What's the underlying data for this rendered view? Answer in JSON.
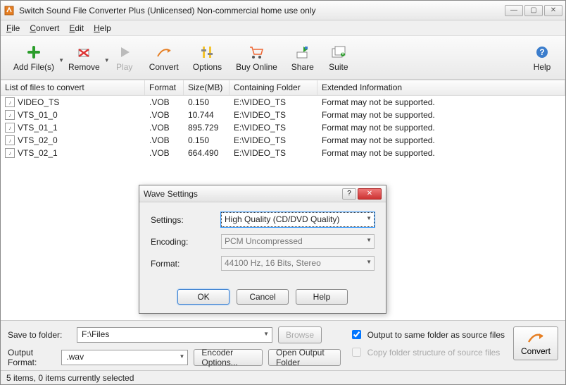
{
  "window": {
    "title": "Switch Sound File Converter Plus (Unlicensed) Non-commercial home use only"
  },
  "menu": {
    "file": "File",
    "convert": "Convert",
    "edit": "Edit",
    "help": "Help"
  },
  "toolbar": {
    "addfiles": "Add File(s)",
    "remove": "Remove",
    "play": "Play",
    "convert": "Convert",
    "options": "Options",
    "buyonline": "Buy Online",
    "share": "Share",
    "suite": "Suite",
    "help": "Help"
  },
  "columns": {
    "file": "List of files to convert",
    "format": "Format",
    "size": "Size(MB)",
    "folder": "Containing Folder",
    "ext": "Extended Information"
  },
  "rows": [
    {
      "name": "VIDEO_TS",
      "fmt": ".VOB",
      "size": "0.150",
      "folder": "E:\\VIDEO_TS",
      "ext": "Format may not be supported."
    },
    {
      "name": "VTS_01_0",
      "fmt": ".VOB",
      "size": "10.744",
      "folder": "E:\\VIDEO_TS",
      "ext": "Format may not be supported."
    },
    {
      "name": "VTS_01_1",
      "fmt": ".VOB",
      "size": "895.729",
      "folder": "E:\\VIDEO_TS",
      "ext": "Format may not be supported."
    },
    {
      "name": "VTS_02_0",
      "fmt": ".VOB",
      "size": "0.150",
      "folder": "E:\\VIDEO_TS",
      "ext": "Format may not be supported."
    },
    {
      "name": "VTS_02_1",
      "fmt": ".VOB",
      "size": "664.490",
      "folder": "E:\\VIDEO_TS",
      "ext": "Format may not be supported."
    }
  ],
  "dialog": {
    "title": "Wave Settings",
    "settings_lbl": "Settings:",
    "settings_val": "High Quality (CD/DVD Quality)",
    "encoding_lbl": "Encoding:",
    "encoding_val": "PCM Uncompressed",
    "format_lbl": "Format:",
    "format_val": "44100 Hz, 16 Bits, Stereo",
    "ok": "OK",
    "cancel": "Cancel",
    "help": "Help"
  },
  "bottom": {
    "savelbl": "Save to folder:",
    "saveval": "F:\\Files",
    "browse": "Browse",
    "outlbl": "Output Format:",
    "outval": ".wav",
    "encopt": "Encoder Options...",
    "openfolder": "Open Output Folder",
    "chk1": "Output to same folder as source files",
    "chk2": "Copy folder structure of source files",
    "convert": "Convert"
  },
  "status": "5 items, 0 items currently selected"
}
